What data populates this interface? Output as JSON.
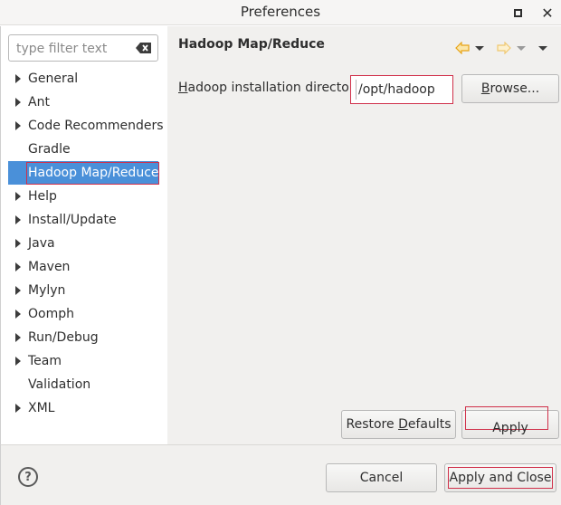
{
  "window": {
    "title": "Preferences"
  },
  "filter": {
    "placeholder": "type filter text"
  },
  "tree": {
    "items": [
      {
        "label": "General",
        "expandable": true
      },
      {
        "label": "Ant",
        "expandable": true
      },
      {
        "label": "Code Recommenders",
        "expandable": true
      },
      {
        "label": "Gradle",
        "expandable": false
      },
      {
        "label": "Hadoop Map/Reduce",
        "expandable": false,
        "selected": true
      },
      {
        "label": "Help",
        "expandable": true
      },
      {
        "label": "Install/Update",
        "expandable": true
      },
      {
        "label": "Java",
        "expandable": true
      },
      {
        "label": "Maven",
        "expandable": true
      },
      {
        "label": "Mylyn",
        "expandable": true
      },
      {
        "label": "Oomph",
        "expandable": true
      },
      {
        "label": "Run/Debug",
        "expandable": true
      },
      {
        "label": "Team",
        "expandable": true
      },
      {
        "label": "Validation",
        "expandable": false
      },
      {
        "label": "XML",
        "expandable": true
      }
    ]
  },
  "page": {
    "title": "Hadoop Map/Reduce",
    "dir_label_first": "H",
    "dir_label_rest": "adoop installation directory:",
    "dir_value": "/opt/hadoop",
    "browse_first": "B",
    "browse_rest": "rowse..."
  },
  "buttons": {
    "restore_pre": "Restore ",
    "restore_u": "D",
    "restore_post": "efaults",
    "apply": "Apply",
    "cancel": "Cancel",
    "apply_close": "Apply and Close"
  },
  "colors": {
    "selection": "#4a90d9",
    "highlight": "#d0304a",
    "nav_arrow": "#e8a416"
  }
}
